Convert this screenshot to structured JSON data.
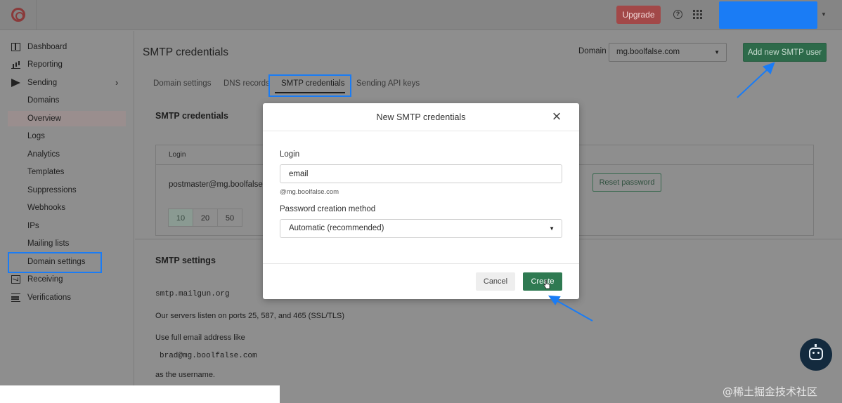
{
  "topbar": {
    "upgrade_label": "Upgrade",
    "help_glyph": "?"
  },
  "sidebar": {
    "items": [
      {
        "label": "Dashboard",
        "icon": "dashboard-icon"
      },
      {
        "label": "Reporting",
        "icon": "reporting-icon"
      },
      {
        "label": "Sending",
        "icon": "send-icon",
        "chevron": "›"
      },
      {
        "label": "Domains"
      },
      {
        "label": "Overview"
      },
      {
        "label": "Logs"
      },
      {
        "label": "Analytics"
      },
      {
        "label": "Templates"
      },
      {
        "label": "Suppressions"
      },
      {
        "label": "Webhooks"
      },
      {
        "label": "IPs"
      },
      {
        "label": "Mailing lists"
      },
      {
        "label": "Domain settings"
      },
      {
        "label": "Receiving",
        "icon": "mail-icon"
      },
      {
        "label": "Verifications",
        "icon": "list-icon"
      }
    ]
  },
  "main": {
    "title": "SMTP credentials",
    "domain_label": "Domain",
    "domain_value": "mg.boolfalse.com",
    "add_button": "Add new SMTP user",
    "tabs": [
      "Domain settings",
      "DNS records",
      "SMTP credentials",
      "Sending API keys"
    ],
    "credentials": {
      "title": "SMTP credentials",
      "column_login": "Login",
      "row_login": "postmaster@mg.boolfalse.c",
      "reset_label": "Reset password",
      "page_sizes": [
        "10",
        "20",
        "50"
      ]
    },
    "settings": {
      "title": "SMTP settings",
      "host": "smtp.mailgun.org",
      "ports_text": "Our servers listen on ports  25,  587, and  465  (SSL/TLS)",
      "username_hint": "Use full email address like",
      "example_email": "brad@mg.boolfalse.com",
      "username_suffix": "as the username."
    }
  },
  "modal": {
    "title": "New SMTP credentials",
    "close_glyph": "×",
    "login_label": "Login",
    "login_value": "email",
    "login_suffix": "@mg.boolfalse.com",
    "method_label": "Password creation method",
    "method_value": "Automatic (recommended)",
    "cancel_label": "Cancel",
    "create_label": "Create"
  },
  "watermark": "@稀土掘金技术社区",
  "colors": {
    "highlight": "#1a7cf5",
    "primary_green": "#2f7a52",
    "upgrade_red": "#a24848"
  }
}
